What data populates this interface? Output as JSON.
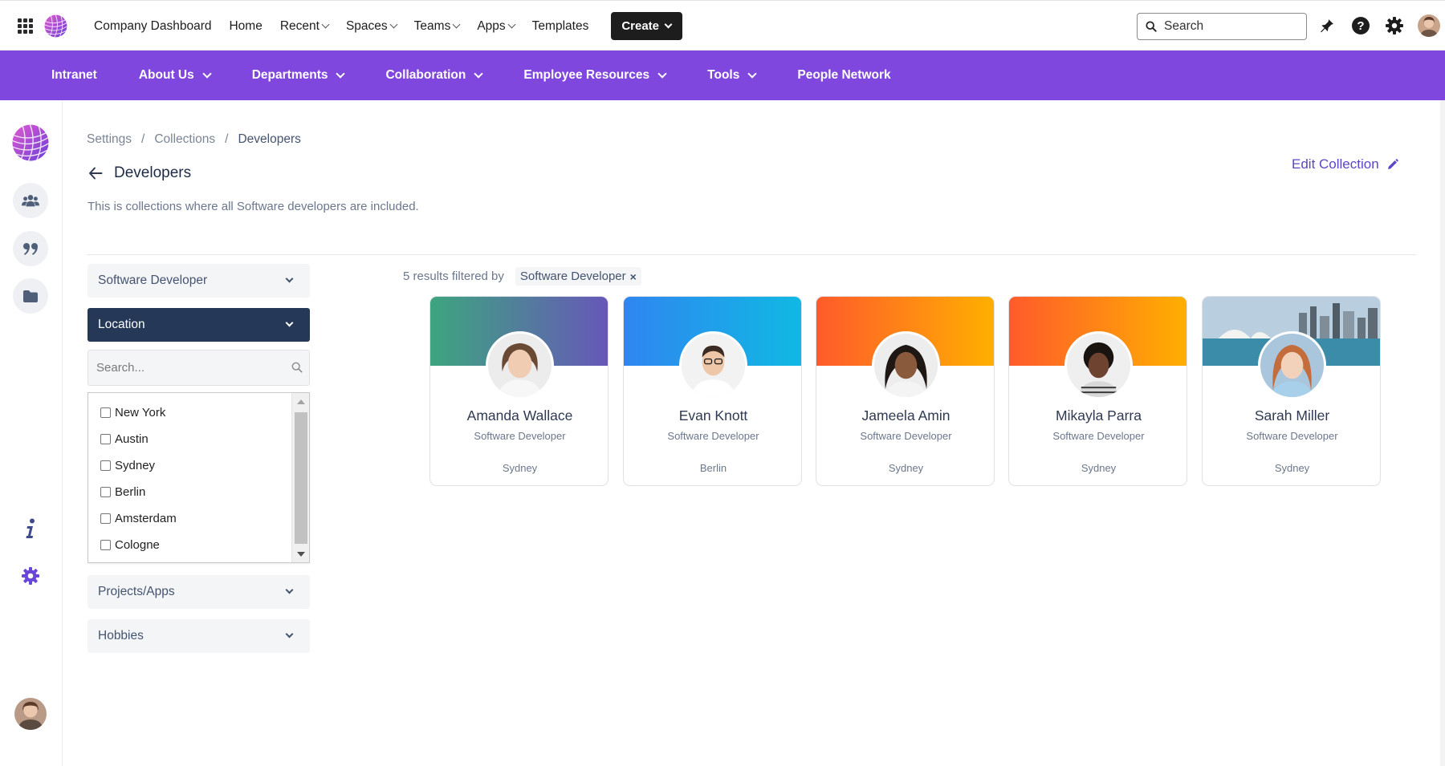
{
  "topbar": {
    "brand": "Company Dashboard",
    "nav": [
      {
        "label": "Home",
        "dropdown": false
      },
      {
        "label": "Recent",
        "dropdown": true
      },
      {
        "label": "Spaces",
        "dropdown": true
      },
      {
        "label": "Teams",
        "dropdown": true
      },
      {
        "label": "Apps",
        "dropdown": true
      },
      {
        "label": "Templates",
        "dropdown": false
      }
    ],
    "create_label": "Create",
    "search_placeholder": "Search",
    "icons": [
      "apps-grid-icon",
      "notifications-bell-icon",
      "help-icon",
      "settings-gear-icon",
      "user-avatar"
    ]
  },
  "mainnav": {
    "items": [
      {
        "label": "Intranet",
        "dropdown": false
      },
      {
        "label": "About Us",
        "dropdown": true
      },
      {
        "label": "Departments",
        "dropdown": true
      },
      {
        "label": "Collaboration",
        "dropdown": true
      },
      {
        "label": "Employee Resources",
        "dropdown": true
      },
      {
        "label": "Tools",
        "dropdown": true
      },
      {
        "label": "People Network",
        "dropdown": false
      }
    ],
    "background": "#7f47dd"
  },
  "rail": {
    "icons": [
      "people-icon",
      "quote-icon",
      "folder-icon",
      "info-icon",
      "settings-gear-icon",
      "user-avatar"
    ]
  },
  "breadcrumb": [
    "Settings",
    "Collections",
    "Developers"
  ],
  "page": {
    "title": "Developers",
    "description": "This is collections where all Software developers are included.",
    "edit_label": "Edit Collection"
  },
  "filters": {
    "facets": [
      "Software Developer",
      "Location",
      "Projects/Apps",
      "Hobbies"
    ],
    "active_facet": "Location",
    "search_placeholder": "Search...",
    "locations": [
      "New York",
      "Austin",
      "Sydney",
      "Berlin",
      "Amsterdam",
      "Cologne"
    ]
  },
  "results": {
    "summary": "5 results filtered by",
    "chip": "Software Developer",
    "chip_close": "×",
    "people": [
      {
        "name": "Amanda Wallace",
        "role": "Software Developer",
        "location": "Sydney"
      },
      {
        "name": "Evan Knott",
        "role": "Software Developer",
        "location": "Berlin"
      },
      {
        "name": "Jameela Amin",
        "role": "Software Developer",
        "location": "Sydney"
      },
      {
        "name": "Mikayla Parra",
        "role": "Software Developer",
        "location": "Sydney"
      },
      {
        "name": "Sarah Miller",
        "role": "Software Developer",
        "location": "Sydney"
      }
    ]
  },
  "colors": {
    "accent": "#7f47dd",
    "active_facet": "#253858",
    "link": "#5b46c8"
  }
}
